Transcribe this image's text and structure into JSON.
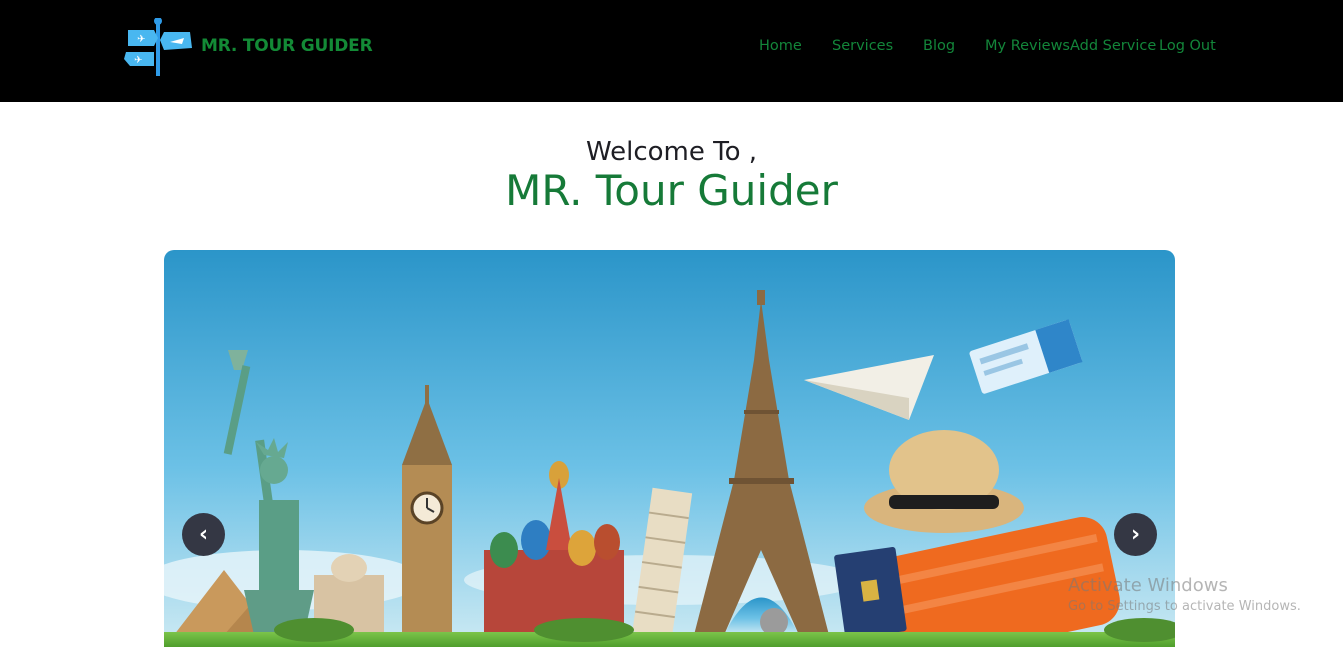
{
  "header": {
    "brand": "MR. TOUR GUIDER",
    "nav": [
      "Home",
      "Services",
      "Blog",
      "My Reviews",
      "Add Service",
      "Log Out"
    ]
  },
  "hero": {
    "welcome": "Welcome To ,",
    "title": "MR. Tour Guider"
  },
  "carousel": {
    "prev_icon": "‹",
    "next_icon": "›"
  },
  "watermark": {
    "title": "Activate Windows",
    "subtitle": "Go to Settings to activate Windows."
  },
  "colors": {
    "navbar": "#000000",
    "brand_green": "#138a36",
    "arrow_bg": "#343744"
  }
}
